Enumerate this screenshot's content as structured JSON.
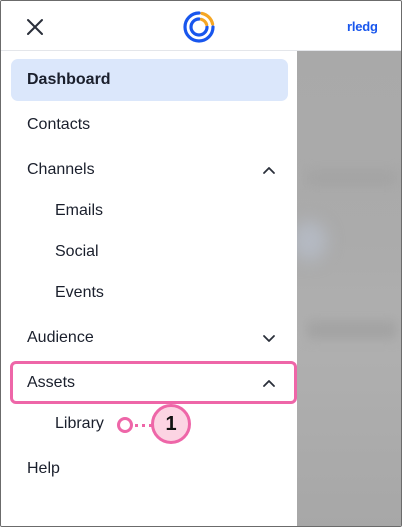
{
  "header": {
    "close_icon": "close-icon",
    "logo_icon": "constant-contact-logo-icon",
    "brand_fragment": "rledg"
  },
  "sidebar": {
    "items": [
      {
        "label": "Dashboard",
        "active": true
      },
      {
        "label": "Contacts"
      },
      {
        "label": "Channels",
        "expanded": true,
        "chevron": "chevron-up-icon"
      },
      {
        "label": "Emails",
        "sub": true
      },
      {
        "label": "Social",
        "sub": true
      },
      {
        "label": "Events",
        "sub": true
      },
      {
        "label": "Audience",
        "expanded": false,
        "chevron": "chevron-down-icon"
      },
      {
        "label": "Assets",
        "expanded": true,
        "chevron": "chevron-up-icon",
        "highlighted": true
      },
      {
        "label": "Library",
        "sub": true
      },
      {
        "label": "Help"
      }
    ]
  },
  "callout": {
    "number": "1"
  },
  "colors": {
    "accent_blue": "#1856ed",
    "active_bg": "#dbe7fb",
    "highlight_pink": "#ee66a8",
    "badge_fill": "#fcd4e3",
    "logo_orange": "#f5a623"
  }
}
